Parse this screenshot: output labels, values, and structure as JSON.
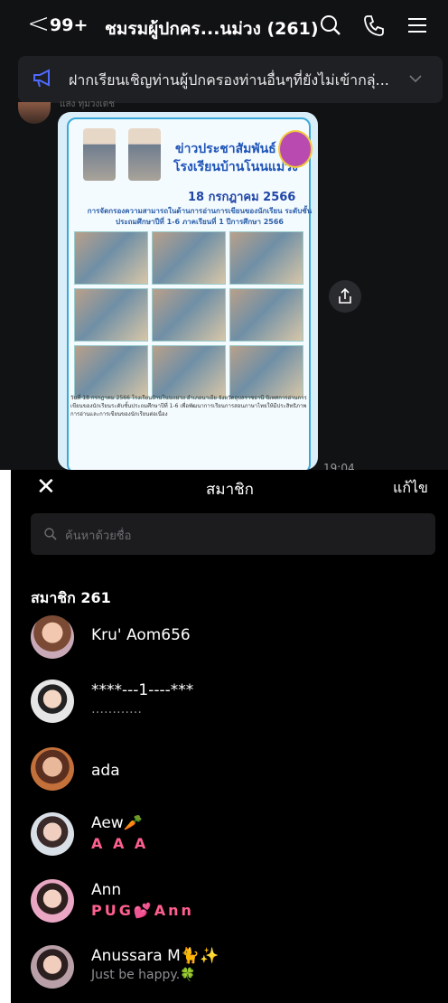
{
  "header": {
    "back_label": "<",
    "unread_count": "99+",
    "title": "ชมรมผู้ปกคร...นม่วง (261)"
  },
  "notice": {
    "text": "ฝากเรียนเชิญท่านผู้ปกครองท่านอื่นๆที่ยังไม่เข้ากลุ่..."
  },
  "message": {
    "sender": "แสง ทุมวงเดช",
    "time": "19:04",
    "poster": {
      "title_line1": "ข่าวประชาสัมพันธ์",
      "title_line2": "โรงเรียนบ้านโนนแม่วง",
      "date": "18 กรกฎาคม 2566",
      "subtitle": "การจัดกรองความสามารถในด้านการอ่านการเขียนของนักเรียน ระดับชั้นประถมศึกษาปีที่ 1-6 ภาคเรียนที่ 1 ปีการศึกษา 2566",
      "body": "วันที่ 18 กรกฎาคม 2566 โรงเรียนบ้านโนนแม่วง อำเภอนาเยีย จังหวัดอุบลราชธานี นิเทศการอ่านการเขียนของนักเรียนระดับชั้นประถมศึกษาปีที่ 1-6 เพื่อพัฒนาการเรียนการสอนภาษาไทยให้มีประสิทธิภาพ การอ่านและการเขียนของนักเรียนต่อเนื่อง"
    }
  },
  "sheet": {
    "close_label": "✕",
    "title": "สมาชิก",
    "edit_label": "แก้ไข",
    "search_placeholder": "ค้นหาด้วยชื่อ",
    "members_label": "สมาชิก 261"
  },
  "members": [
    {
      "name": "Kru' Aom656",
      "status": ""
    },
    {
      "name": "****---1----***",
      "status": "…………"
    },
    {
      "name": "ada",
      "status": ""
    },
    {
      "name": "Aew🥕",
      "status": "A A A"
    },
    {
      "name": "Ann",
      "status": "PUG💕Ann"
    },
    {
      "name": "Anussara M🐈✨",
      "status": "Just be happy.🍀"
    }
  ],
  "colors": {
    "background": "#111214",
    "sheet": "#000000",
    "accent_pink": "#ff5f8f",
    "accent_blue": "#9ed8ff",
    "notice_icon": "#4f6bff"
  }
}
